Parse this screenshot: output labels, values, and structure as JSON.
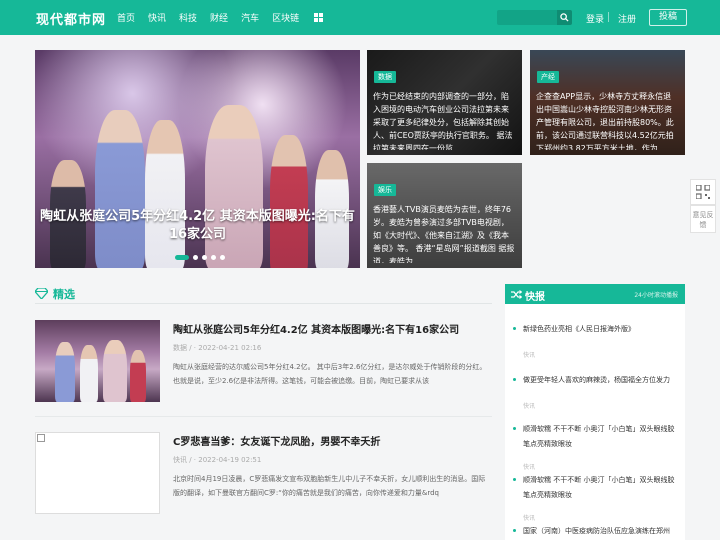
{
  "header": {
    "logo": "现代都市网",
    "nav": [
      "首页",
      "快讯",
      "科技",
      "财经",
      "汽车",
      "区块链"
    ],
    "login": "登录",
    "register": "注册",
    "post": "投稿",
    "search_placeholder": ""
  },
  "hero": {
    "title": "陶虹从张庭公司5年分红4.2亿 其资本版图曝光:名下有16家公司",
    "slides": 5,
    "active_slide": 1
  },
  "cards": [
    {
      "tag": "数据",
      "text": "作为已经结束的内部调查的一部分，陷入困境的电动汽车创业公司法拉第未来采取了更多纪律处分，包括解除其创始人、前CEO贾跃亭的执行官职务。 据法拉第未来周四在一份监"
    },
    {
      "tag": "产经",
      "text": "企查查APP显示，少林寺方丈释永信退出中国嵩山少林寺控股河南少林无形资产管理有限公司，退出前持股80%。此前，该公司通过联营科技以4.52亿元拍下郑州约3.82万平方米土地，作为"
    },
    {
      "tag": "娱乐",
      "text": "香港藝人TVB演员麦皓为去世，终年76岁。麦皓为曾参演过多部TVB电视剧，如《大时代》、《他来自江湖》及《我本善良》等。 香港“星岛网”报道截图 据报道，麦皓为"
    }
  ],
  "float": {
    "feedback": "意见反馈"
  },
  "featured": {
    "title": "精选",
    "articles": [
      {
        "title": "陶虹从张庭公司5年分红4.2亿 其资本版图曝光:名下有16家公司",
        "meta": "数据 / · 2022-04-21 02:16",
        "summary": "陶虹从张庭经营的达尔威公司5年分红4.2亿。 其中后3年2.6亿分红，是达尔威处于传销阶段的分红。也就是说，至少2.6亿是非法所得。这笔钱，可能会被追缴。目前，陶虹已要求从该"
      },
      {
        "title": "C罗悲喜当爹：女友诞下龙凤胎，男婴不幸夭折",
        "meta": "快讯 / · 2022-04-19 02:51",
        "summary": "北京时间4月19日凌晨，C罗悲痛发文宣布双胞胎新生儿中儿子不幸夭折，女儿顺利出生的消息。国际版的翻译，如下曼联官方翻间C罗:“你的痛苦就是我们的痛苦，向你传递爱和力量&rdq"
      }
    ]
  },
  "flash": {
    "title": "快报",
    "subtitle": "24小时滚动播报",
    "items": [
      {
        "text": "新绿色药业亮相《人民日报海外版》",
        "time": "快讯"
      },
      {
        "text": "做更受年轻人喜欢的麻辣烫，杨国福全方位发力",
        "time": "快讯"
      },
      {
        "text": "顺滑软糯 不干不断 小奥汀「小白笔」双头眼线胶笔点亮精致眼妆",
        "time": "快讯"
      },
      {
        "text": "顺滑软糯 不干不断 小奥汀「小白笔」双头眼线胶笔点亮精致眼妆",
        "time": "快讯"
      },
      {
        "text": "国家（河南）中医疫病防治队伍应急演练在郑州",
        "time": ""
      }
    ]
  },
  "colors": {
    "accent": "#16b898"
  }
}
